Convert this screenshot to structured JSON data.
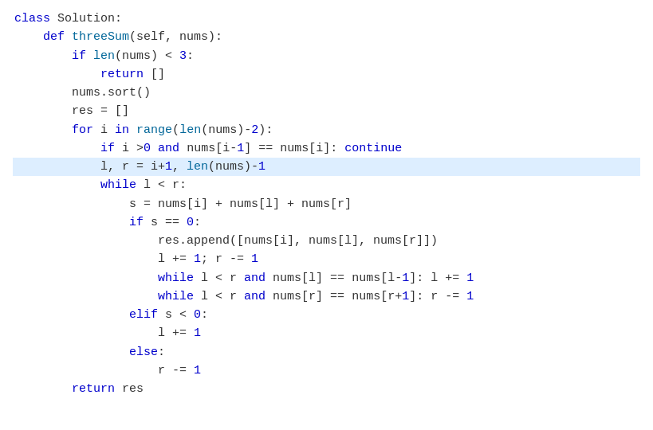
{
  "code": {
    "lines": [
      {
        "text": "class Solution:",
        "highlighted": false
      },
      {
        "text": "    def threeSum(self, nums):",
        "highlighted": false
      },
      {
        "text": "        if len(nums) < 3:",
        "highlighted": false
      },
      {
        "text": "            return []",
        "highlighted": false
      },
      {
        "text": "        nums.sort()",
        "highlighted": false
      },
      {
        "text": "        res = []",
        "highlighted": false
      },
      {
        "text": "        for i in range(len(nums)-2):",
        "highlighted": false
      },
      {
        "text": "            if i >0 and nums[i-1] == nums[i]: continue",
        "highlighted": false
      },
      {
        "text": "            l, r = i+1, len(nums)-1",
        "highlighted": true
      },
      {
        "text": "            while l < r:",
        "highlighted": false
      },
      {
        "text": "                s = nums[i] + nums[l] + nums[r]",
        "highlighted": false
      },
      {
        "text": "                if s == 0:",
        "highlighted": false
      },
      {
        "text": "                    res.append([nums[i], nums[l], nums[r]])",
        "highlighted": false
      },
      {
        "text": "                    l += 1; r -= 1",
        "highlighted": false
      },
      {
        "text": "                    while l < r and nums[l] == nums[l-1]: l += 1",
        "highlighted": false
      },
      {
        "text": "                    while l < r and nums[r] == nums[r+1]: r -= 1",
        "highlighted": false
      },
      {
        "text": "                elif s < 0:",
        "highlighted": false
      },
      {
        "text": "                    l += 1",
        "highlighted": false
      },
      {
        "text": "                else:",
        "highlighted": false
      },
      {
        "text": "                    r -= 1",
        "highlighted": false
      },
      {
        "text": "        return res",
        "highlighted": false
      }
    ]
  }
}
